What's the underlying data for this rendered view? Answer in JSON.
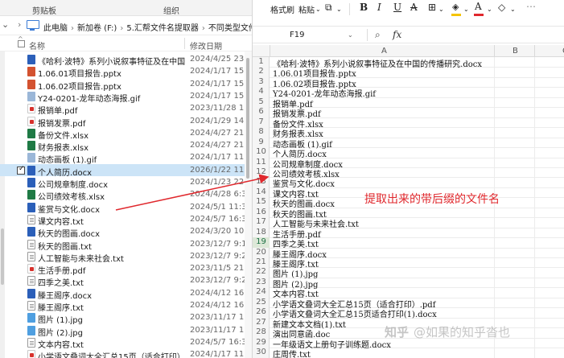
{
  "explorer": {
    "ribbon": {
      "clipboard_label": "剪贴板",
      "organize_label": "组织"
    },
    "address": {
      "crumbs": [
        "此电脑",
        "新加卷 (F:)",
        "5.汇帮文件名提取器",
        "不同类型文件"
      ]
    },
    "columns": {
      "name": "名称",
      "date": "修改日期"
    },
    "files": [
      {
        "name": "《哈利·波特》系列小说叙事特征及在中国的...",
        "date": "2024/4/25 23:51",
        "type": "docx"
      },
      {
        "name": "1.06.01项目报告.pptx",
        "date": "2024/1/17 15:11",
        "type": "pptx"
      },
      {
        "name": "1.06.02项目报告.pptx",
        "date": "2024/1/17 15:11",
        "type": "pptx"
      },
      {
        "name": "Y24-0201-龙年动态海报.gif",
        "date": "2024/1/17 15:19",
        "type": "gif"
      },
      {
        "name": "报销单.pdf",
        "date": "2023/11/28 11:08",
        "type": "pdf"
      },
      {
        "name": "报销发票.pdf",
        "date": "2024/1/29 14:15",
        "type": "pdf"
      },
      {
        "name": "备份文件.xlsx",
        "date": "2024/4/27 21:29",
        "type": "xlsx"
      },
      {
        "name": "财务报表.xlsx",
        "date": "2024/4/27 21:29",
        "type": "xlsx"
      },
      {
        "name": "动态画板 (1).gif",
        "date": "2024/1/17 11:02",
        "type": "gif"
      },
      {
        "name": "个人简历.docx",
        "date": "2026/1/22 11:25",
        "type": "docx",
        "selected": true
      },
      {
        "name": "公司规章制度.docx",
        "date": "2024/1/23 22:32",
        "type": "docx"
      },
      {
        "name": "公司绩效考核.xlsx",
        "date": "2024/4/28 6:33",
        "type": "xlsx"
      },
      {
        "name": "鉴赏与文化.docx",
        "date": "2024/5/1 11:34",
        "type": "docx"
      },
      {
        "name": "课文内容.txt",
        "date": "2024/5/7 16:33",
        "type": "txt"
      },
      {
        "name": "秋天的图画.docx",
        "date": "2024/3/20 10:02",
        "type": "docx"
      },
      {
        "name": "秋天的图画.txt",
        "date": "2023/12/7 9:19",
        "type": "txt"
      },
      {
        "name": "人工智能与未来社会.txt",
        "date": "2023/12/7 9:20",
        "type": "txt"
      },
      {
        "name": "生活手册.pdf",
        "date": "2023/11/5 21:53",
        "type": "pdf"
      },
      {
        "name": "四季之美.txt",
        "date": "2023/12/7 9:21",
        "type": "txt"
      },
      {
        "name": "滕王阁序.docx",
        "date": "2024/4/12 16:29",
        "type": "docx"
      },
      {
        "name": "滕王阁序.txt",
        "date": "2024/4/12 16:29",
        "type": "txt"
      },
      {
        "name": "图片 (1).jpg",
        "date": "2023/11/17 11:08",
        "type": "jpg"
      },
      {
        "name": "图片 (2).jpg",
        "date": "2023/11/17 11:08",
        "type": "jpg"
      },
      {
        "name": "文本内容.txt",
        "date": "2024/5/7 16:33",
        "type": "txt"
      },
      {
        "name": "小学语文叠词大全汇总15页（适合打印）.pdf",
        "date": "2024/1/17 11:08",
        "type": "pdf"
      }
    ]
  },
  "sheet": {
    "toolbar": {
      "format_brush": "格式刷",
      "paste": "粘贴",
      "bold": "B",
      "italic": "I",
      "underline": "U",
      "strike": "A",
      "accent_fill": "#f5c400",
      "accent_font": "#e0282d"
    },
    "name_box": "F19",
    "columns": [
      "A",
      "B",
      "C"
    ],
    "active_row": 19,
    "rows": [
      "《哈利·波特》系列小说叙事特征及在中国的传播研究.docx",
      "1.06.01项目报告.pptx",
      "1.06.02项目报告.pptx",
      "Y24-0201-龙年动态海报.gif",
      "报销单.pdf",
      "报销发票.pdf",
      "备份文件.xlsx",
      "财务报表.xlsx",
      "动态画板 (1).gif",
      "个人简历.docx",
      "公司规章制度.docx",
      "公司绩效考核.xlsx",
      "鉴赏与文化.docx",
      "课文内容.txt",
      "秋天的图画.docx",
      "秋天的图画.txt",
      "人工智能与未来社会.txt",
      "生活手册.pdf",
      "四季之美.txt",
      "滕王阁序.docx",
      "滕王阁序.txt",
      "图片 (1).jpg",
      "图片 (2).jpg",
      "文本内容.txt",
      "小学语文叠词大全汇总15页（适合打印）.pdf",
      "小学语文叠词大全汇总15页适合打印(1).docx",
      "新建文本文档(1).txt",
      "演出同意函.doc",
      "一年级语文上册句子训练题.docx",
      "庄周传.txt"
    ]
  },
  "annotation": "提取出来的带后缀的文件名",
  "watermark": {
    "logo": "知乎",
    "text": "@如果的知乎沓也"
  }
}
